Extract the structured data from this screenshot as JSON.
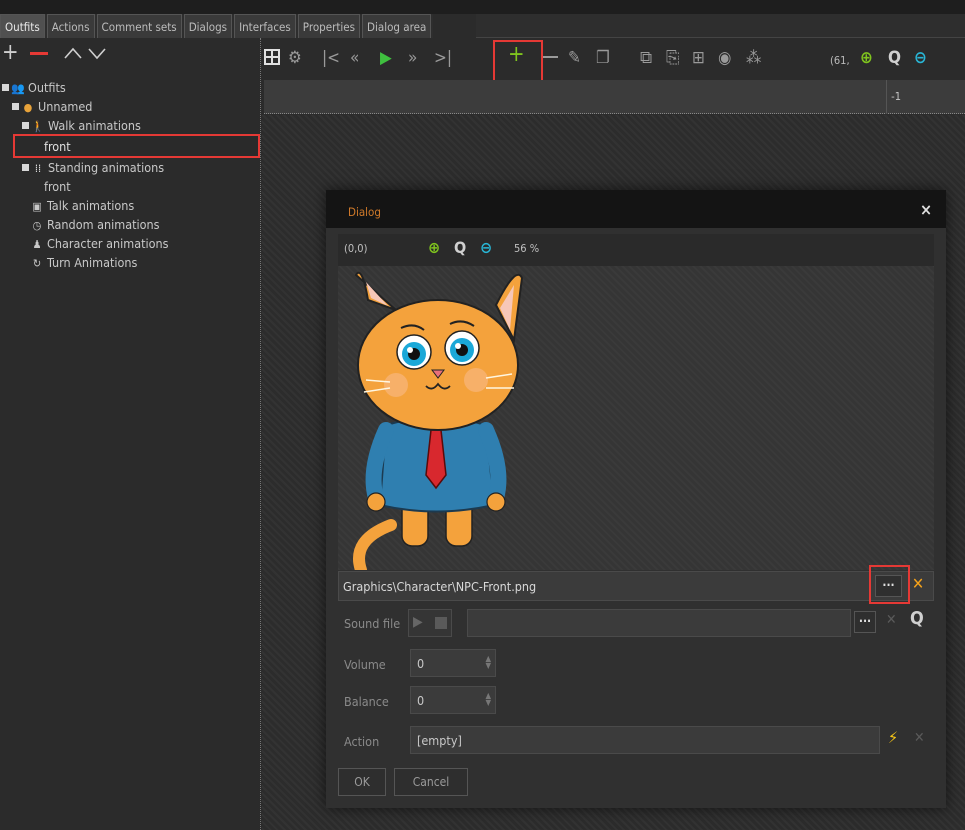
{
  "tabs": [
    "Outfits",
    "Actions",
    "Comment sets",
    "Dialogs",
    "Interfaces",
    "Properties",
    "Dialog area"
  ],
  "left_toolbar": {
    "add": "+",
    "remove": "—",
    "up": "^",
    "down": "v"
  },
  "tree": {
    "root": "Outfits",
    "outfit": "Unnamed",
    "walk": "Walk animations",
    "walk_child": "front",
    "standing": "Standing animations",
    "standing_child": "front",
    "talk": "Talk animations",
    "random": "Random animations",
    "character": "Character animations",
    "turn": "Turn Animations"
  },
  "toolbar": {
    "coord": "(61,",
    "row_value": "-1"
  },
  "dialog": {
    "title": "Dialog",
    "close": "×",
    "coord": "(0,0)",
    "zoom": "56 %",
    "graphic_path": "Graphics\\Character\\NPC-Front.png",
    "browse": "···",
    "sound_label": "Sound file",
    "volume_label": "Volume",
    "volume_value": "0",
    "balance_label": "Balance",
    "balance_value": "0",
    "action_label": "Action",
    "action_value": "[empty]",
    "ok": "OK",
    "cancel": "Cancel"
  },
  "colors": {
    "highlight": "#e53935",
    "green": "#7fc41e",
    "cyan": "#29b6d6",
    "orange": "#d07a2a",
    "yellow": "#f5c518"
  }
}
